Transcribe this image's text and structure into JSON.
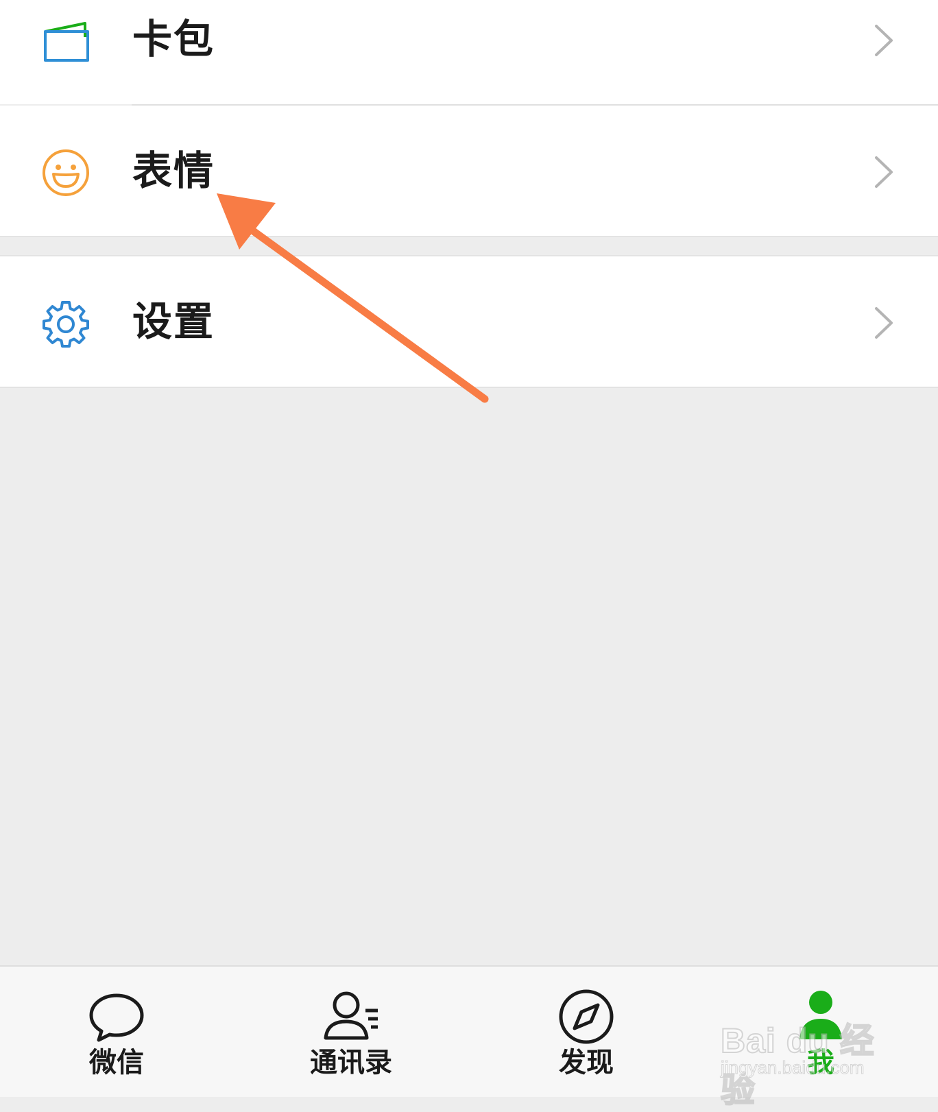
{
  "menu": {
    "items": [
      {
        "label": "卡包",
        "icon": "card-wallet-icon"
      },
      {
        "label": "表情",
        "icon": "smiley-face-icon"
      },
      {
        "label": "设置",
        "icon": "gear-icon"
      }
    ]
  },
  "tabbar": {
    "tabs": [
      {
        "label": "微信",
        "icon": "chat-bubble-icon",
        "active": false
      },
      {
        "label": "通讯录",
        "icon": "contacts-icon",
        "active": false
      },
      {
        "label": "发现",
        "icon": "compass-icon",
        "active": false
      },
      {
        "label": "我",
        "icon": "person-icon",
        "active": true
      }
    ]
  },
  "watermark": {
    "main": "Bai du 经验",
    "sub": "jingyan.baidu.com"
  },
  "colors": {
    "accent_green": "#1aad19",
    "arrow_orange": "#f87c45",
    "card_blue": "#2f8fd6",
    "card_green": "#1aad19",
    "smiley_orange": "#f5a13b",
    "gear_blue": "#2f87d2",
    "page_bg": "#ededed"
  }
}
